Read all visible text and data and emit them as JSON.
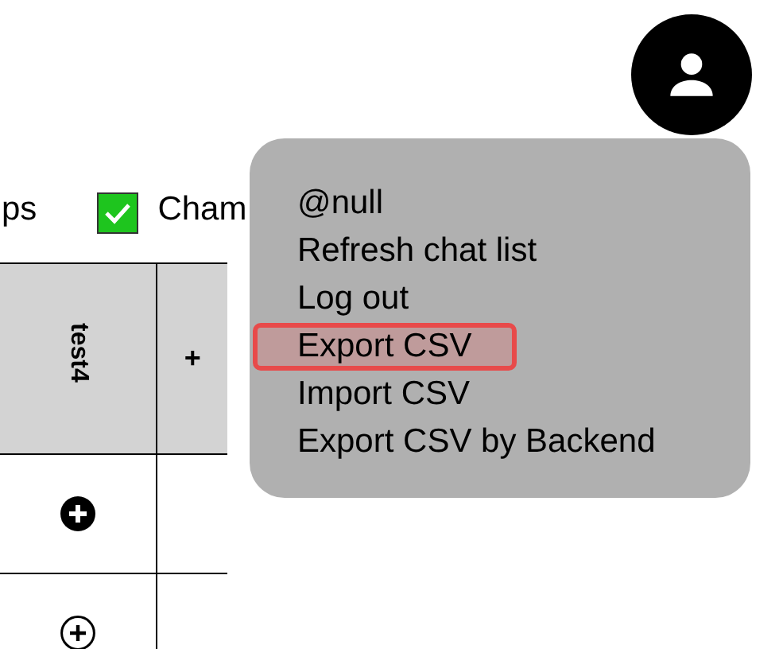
{
  "toolbar": [
    {
      "kind": "text",
      "label": "ps"
    },
    {
      "kind": "checkbox",
      "label": "Cham",
      "checked": true
    }
  ],
  "table": {
    "columns": [
      {
        "kind": "text",
        "label": "test4"
      },
      {
        "kind": "add",
        "label": "+"
      }
    ],
    "rows": [
      {
        "kind": "filled"
      },
      {
        "kind": "outline"
      }
    ]
  },
  "user_menu": {
    "items": [
      {
        "label": "@null",
        "selected": false
      },
      {
        "label": "Refresh chat list",
        "selected": false
      },
      {
        "label": "Log out",
        "selected": false
      },
      {
        "label": "Export CSV",
        "selected": true
      },
      {
        "label": "Import CSV",
        "selected": false
      },
      {
        "label": "Export CSV by Backend",
        "selected": false
      }
    ]
  }
}
